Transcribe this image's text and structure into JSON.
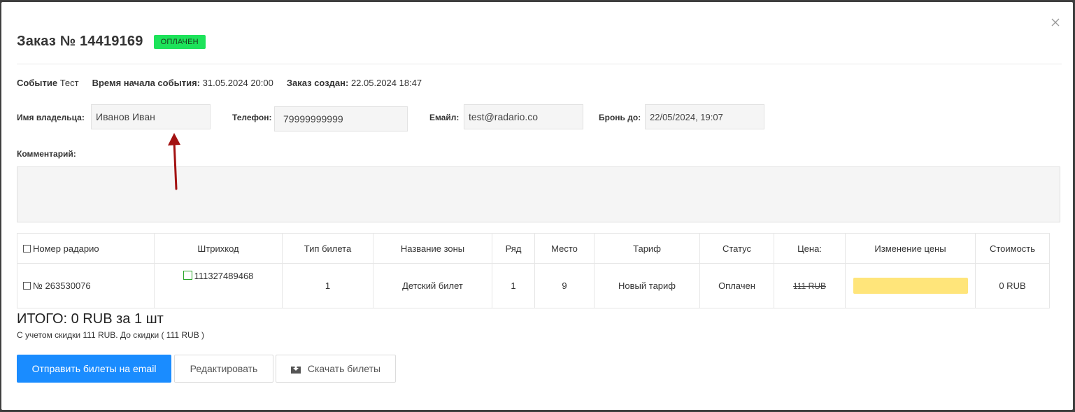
{
  "order": {
    "title": "Заказ № 14419169",
    "status_badge": "ОПЛАЧЕН",
    "status_color": "#1de35a"
  },
  "info": {
    "event_label": "Событие",
    "event_value": "Тест",
    "start_label": "Время начала события:",
    "start_value": "31.05.2024 20:00",
    "created_label": "Заказ создан:",
    "created_value": "22.05.2024 18:47"
  },
  "fields": {
    "owner_label": "Имя владельца:",
    "owner_value": "Иванов Иван",
    "phone_label": "Телефон:",
    "phone_value": "79999999999",
    "email_label": "Емайл:",
    "email_value": "test@radario.co",
    "reserve_label": "Бронь до:",
    "reserve_value": "22/05/2024, 19:07",
    "comment_label": "Комментарий:",
    "comment_value": ""
  },
  "table": {
    "headers": [
      "Номер радарио",
      "Штрихкод",
      "Тип билета",
      "Название зоны",
      "Ряд",
      "Место",
      "Тариф",
      "Статус",
      "Цена:",
      "Изменение цены",
      "Стоимость"
    ],
    "rows": [
      {
        "number": "№ 263530076",
        "barcode": "111327489468",
        "ticket_type": "1",
        "zone": "Детский билет",
        "row": "1",
        "seat": "9",
        "tariff": "Новый тариф",
        "status": "Оплачен",
        "price": "111 RUB",
        "price_change": "",
        "cost": "0 RUB"
      }
    ]
  },
  "summary": {
    "total": "ИТОГО: 0 RUB за 1 шт",
    "discount_note": "С учетом скидки 111 RUB. До скидки ( 111 RUB )"
  },
  "buttons": {
    "send_email": "Отправить билеты на email",
    "edit": "Редактировать",
    "download": "Скачать билеты"
  },
  "colors": {
    "primary": "#1a8cff",
    "price_change_fill": "#ffe57a",
    "arrow": "#a31212"
  }
}
